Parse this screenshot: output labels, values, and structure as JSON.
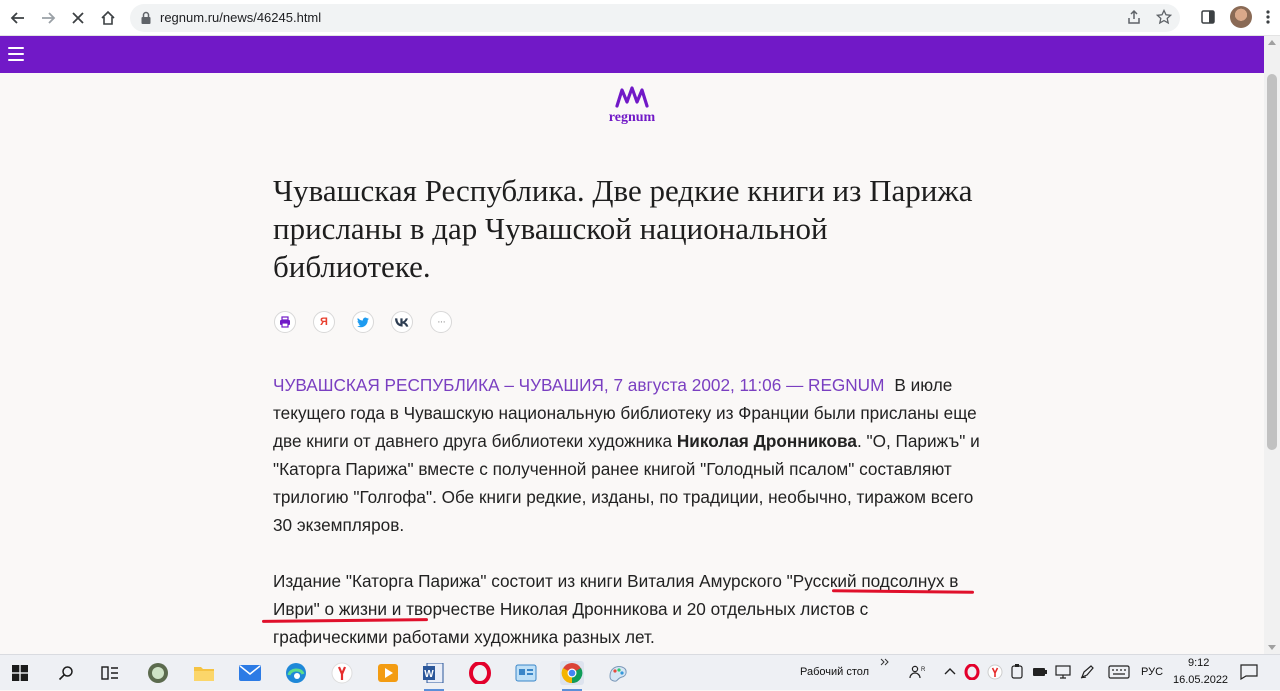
{
  "browser": {
    "url": "regnum.ru/news/46245.html"
  },
  "site": {
    "logo_text": "regnum",
    "brand_color": "#7119c7"
  },
  "article": {
    "headline": "Чувашская Республика. Две редкие книги из Парижа присланы в дар Чувашской национальной библиотеке.",
    "share_icons": [
      "print-icon",
      "yandex-icon",
      "twitter-icon",
      "vk-icon",
      "more-icon"
    ],
    "share_labels": {
      "yandex": "Я",
      "more": "···"
    },
    "dateline": "ЧУВАШСКАЯ РЕСПУБЛИКА – ЧУВАШИЯ, 7 августа 2002, 11:06 — REGNUM",
    "p1_a": "В июле текущего года в Чувашскую национальную библиотеку из Франции были присланы еще две книги от давнего друга библиотеки художника ",
    "p1_bold": "Николая Дронникова",
    "p1_b": ". \"О, Парижъ\" и \"Каторга Парижа\" вместе с полученной ранее книгой \"Голодный псалом\" составляют трилогию \"Голгофа\". Обе книги редкие, изданы, по традиции, необычно, тиражом всего 30 экземпляров.",
    "p2_a": "Издание \"Каторга Парижа\" состоит из книги Виталия Амурского ",
    "p2_highlight": "\"Русский подсолнух в Иври\"",
    "p2_b": " о жизни и творчестве Николая Дронникова и 20 отдельных листов с графическими работами художника разных лет."
  },
  "taskbar": {
    "desktop_label": "Рабочий стол",
    "lang": "РУС",
    "time": "9:12",
    "date": "16.05.2022"
  }
}
